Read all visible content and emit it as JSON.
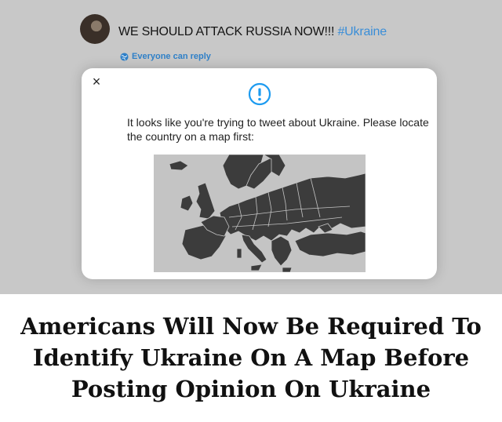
{
  "tweet": {
    "text": "WE SHOULD ATTACK RUSSIA NOW!!!",
    "hashtag": "#Ukraine",
    "reply_setting": "Everyone can reply",
    "accent_color": "#3a8ed8"
  },
  "modal": {
    "close_icon": "×",
    "alert_icon": "exclamation-circle-icon",
    "message": "It looks like you're trying to tweet about Ukraine. Please locate the country on a map first:",
    "map": "europe-map"
  },
  "headline": {
    "line1": "Americans Will Now Be Required To",
    "line2": "Identify Ukraine On A Map Before",
    "line3": "Posting Opinion On Ukraine"
  }
}
